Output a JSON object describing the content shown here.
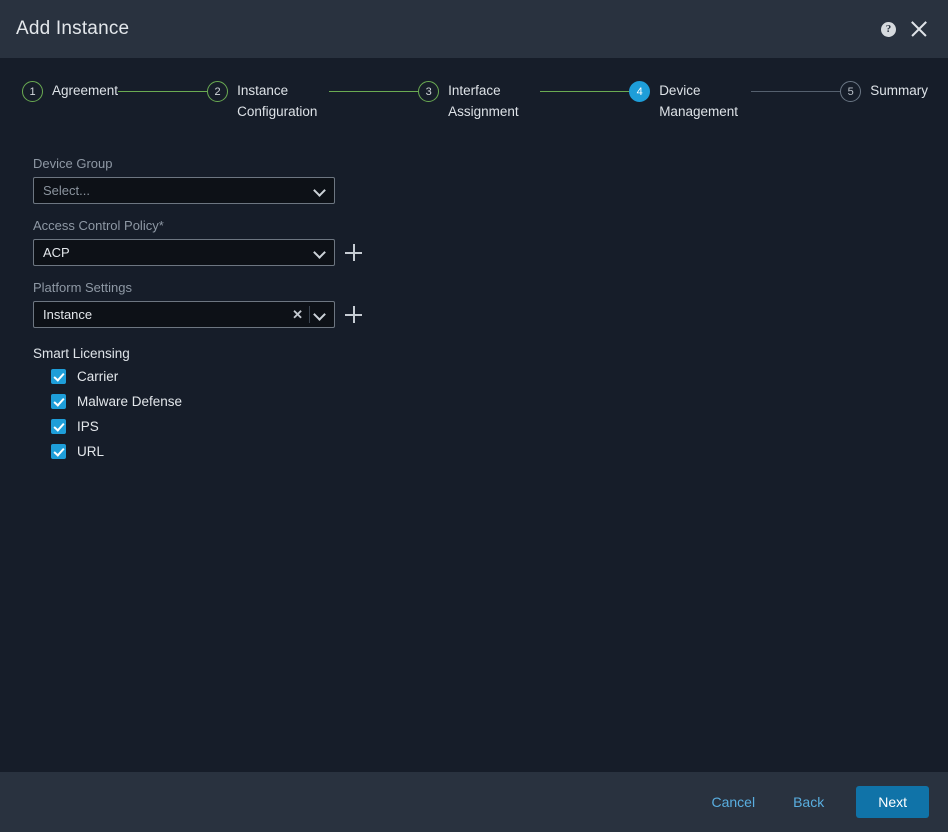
{
  "dialog": {
    "title": "Add Instance",
    "help_icon": "help-circle-icon",
    "close_icon": "close-icon"
  },
  "stepper": {
    "steps": [
      {
        "number": "1",
        "label": "Agreement",
        "state": "done"
      },
      {
        "number": "2",
        "label": "Instance Configuration",
        "state": "done"
      },
      {
        "number": "3",
        "label": "Interface Assignment",
        "state": "done"
      },
      {
        "number": "4",
        "label": "Device Management",
        "state": "active"
      },
      {
        "number": "5",
        "label": "Summary",
        "state": "inactive"
      }
    ],
    "connector_done_color": "#6aab52",
    "connector_inactive_color": "#55606e",
    "active_color": "#1e9ed9"
  },
  "form": {
    "device_group": {
      "label": "Device Group",
      "value": "Select...",
      "is_placeholder": true
    },
    "access_control_policy": {
      "label": "Access Control Policy*",
      "value": "ACP",
      "add_icon": "plus-icon"
    },
    "platform_settings": {
      "label": "Platform Settings",
      "value": "Instance",
      "clear_label": "✕",
      "add_icon": "plus-icon"
    }
  },
  "smart_licensing": {
    "title": "Smart Licensing",
    "options": [
      {
        "label": "Carrier",
        "checked": true
      },
      {
        "label": "Malware Defense",
        "checked": true
      },
      {
        "label": "IPS",
        "checked": true
      },
      {
        "label": "URL",
        "checked": true
      }
    ]
  },
  "footer": {
    "cancel_label": "Cancel",
    "back_label": "Back",
    "next_label": "Next",
    "primary_color": "#1073a8",
    "link_color": "#59aee0"
  }
}
